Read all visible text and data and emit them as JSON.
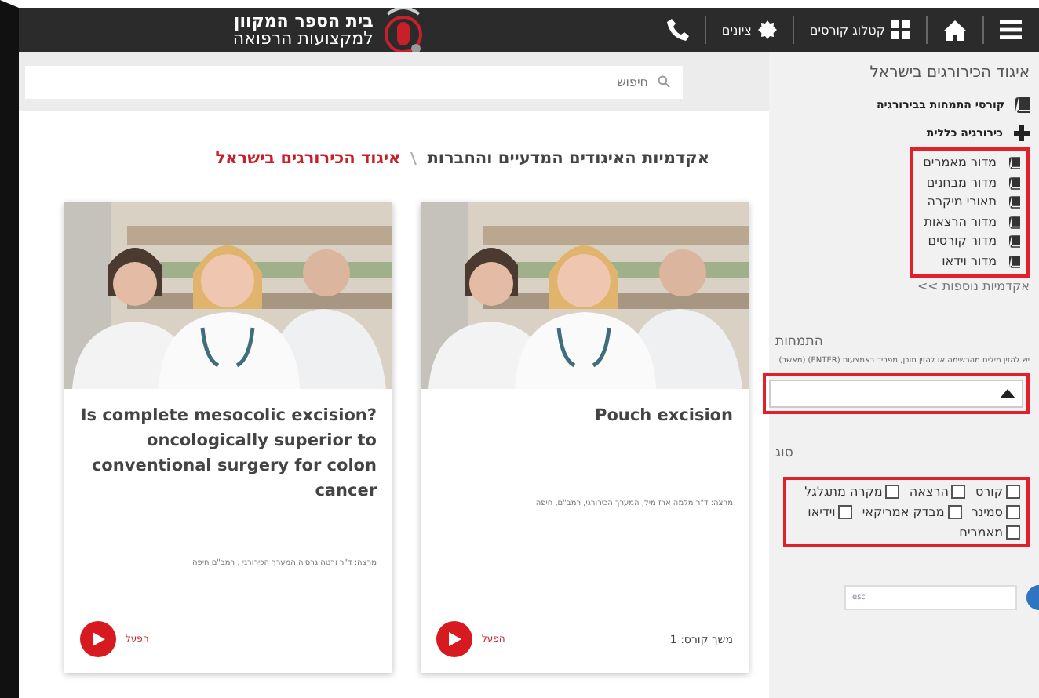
{
  "header": {
    "nav": [
      {
        "kind": "menu"
      },
      {
        "kind": "home"
      },
      {
        "kind": "grid",
        "label": "קטלוג קורסים"
      },
      {
        "kind": "badge",
        "label": "ציונים"
      },
      {
        "kind": "phone"
      }
    ],
    "logo": {
      "line1": "בית הספר המקוון",
      "line2": "למקצועות הרפואה"
    }
  },
  "search": {
    "placeholder": "חיפוש"
  },
  "breadcrumb": [
    {
      "label": "אקדמיות האיגודים המדעיים והחברות",
      "current": false
    },
    {
      "label": "איגוד הכירורגים בישראל",
      "current": true
    }
  ],
  "cards": [
    {
      "title": "Pouch excision",
      "lecturer": "מרצה: ד\"ר מלמה ארז מיל, המערך הכירורגי, רמב\"ם, חיפה",
      "duration": "משך קורס: 1",
      "action": "הפעל"
    },
    {
      "title": "Is complete mesocolic excision? oncologically superior to conventional surgery for colon cancer",
      "lecturer": "מרצה: ד\"ר ורטה גרסיה המערך הכירורגי , רמב\"ם חיפה",
      "action": "הפעל"
    }
  ],
  "sidebar": {
    "title": "איגוד הכירורגים בישראל",
    "course_link": "קורסי התמחות בבירורגיה",
    "category": {
      "label": "כירורגיה כללית",
      "expanded": true,
      "children": [
        "מדור מאמרים",
        "מדור מבחנים",
        "תאורי מיקרה",
        "מדור הרצאות",
        "מדור קורסים",
        "מדור וידאו"
      ]
    },
    "more_link": "אקדמיות נוספות >>",
    "specialty": {
      "label": "התמחות",
      "hint": "יש להזין מילים מהרשימה או להזין תוכן, מפריד באמצעות (ENTER) (מאשר)"
    },
    "type": {
      "label": "סוג",
      "options": [
        {
          "label": "קורס",
          "checked": false
        },
        {
          "label": "הרצאה",
          "checked": false
        },
        {
          "label": "מקרה מתגלגל",
          "checked": false
        },
        {
          "label": "סמינר",
          "checked": false
        },
        {
          "label": "מבדק אמריקאי",
          "checked": false
        },
        {
          "label": "וידיאו",
          "checked": false
        },
        {
          "label": "מאמרים",
          "checked": false
        }
      ]
    },
    "bottom_field": {
      "value": "esc"
    }
  }
}
